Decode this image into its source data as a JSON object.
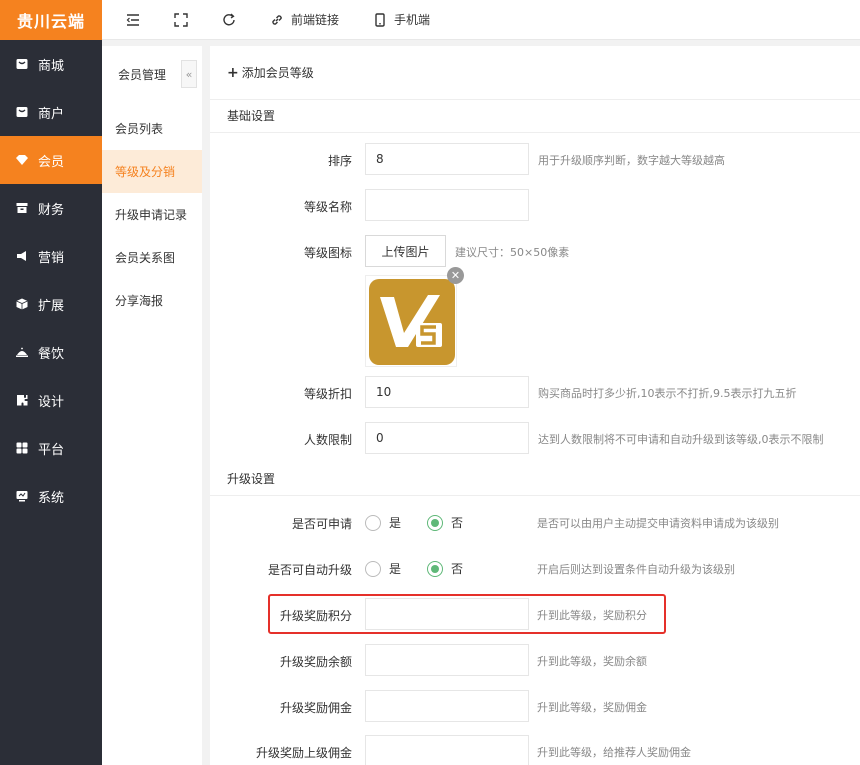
{
  "brand": "贵川云端",
  "nav": [
    {
      "label": "商城",
      "icon": "shop-icon",
      "active": false
    },
    {
      "label": "商户",
      "icon": "merchant-icon",
      "active": false
    },
    {
      "label": "会员",
      "icon": "member-icon",
      "active": true
    },
    {
      "label": "财务",
      "icon": "finance-icon",
      "active": false
    },
    {
      "label": "营销",
      "icon": "marketing-icon",
      "active": false
    },
    {
      "label": "扩展",
      "icon": "extension-icon",
      "active": false
    },
    {
      "label": "餐饮",
      "icon": "dining-icon",
      "active": false
    },
    {
      "label": "设计",
      "icon": "design-icon",
      "active": false
    },
    {
      "label": "平台",
      "icon": "platform-icon",
      "active": false
    },
    {
      "label": "系统",
      "icon": "system-icon",
      "active": false
    }
  ],
  "topbar": {
    "frontend_link": "前端链接",
    "mobile": "手机端"
  },
  "subnav": {
    "title": "会员管理",
    "collapse": "«",
    "items": [
      {
        "label": "会员列表",
        "active": false
      },
      {
        "label": "等级及分销",
        "active": true
      },
      {
        "label": "升级申请记录",
        "active": false
      },
      {
        "label": "会员关系图",
        "active": false
      },
      {
        "label": "分享海报",
        "active": false
      }
    ]
  },
  "main": {
    "add_button": "添加会员等级",
    "basic_section": "基础设置",
    "sort_label": "排序",
    "sort_value": "8",
    "sort_hint": "用于升级顺序判断，数字越大等级越高",
    "name_label": "等级名称",
    "name_value": "",
    "icon_label": "等级图标",
    "upload_button": "上传图片",
    "upload_hint": "建议尺寸：50×50像素",
    "thumb_text": "V5",
    "discount_label": "等级折扣",
    "discount_value": "10",
    "discount_hint": "购买商品时打多少折,10表示不打折,9.5表示打九五折",
    "limit_label": "人数限制",
    "limit_value": "0",
    "limit_hint": "达到人数限制将不可申请和自动升级到该等级,0表示不限制",
    "upgrade_section": "升级设置",
    "apply_label": "是否可申请",
    "apply_yes": "是",
    "apply_no": "否",
    "apply_hint": "是否可以由用户主动提交申请资料申请成为该级别",
    "auto_label": "是否可自动升级",
    "auto_yes": "是",
    "auto_no": "否",
    "auto_hint": "开启后则达到设置条件自动升级为该级别",
    "points_label": "升级奖励积分",
    "points_value": "",
    "points_hint": "升到此等级，奖励积分",
    "balance_label": "升级奖励余额",
    "balance_value": "",
    "balance_hint": "升到此等级，奖励余额",
    "commission_label": "升级奖励佣金",
    "commission_value": "",
    "commission_hint": "升到此等级，奖励佣金",
    "parent_label": "升级奖励上级佣金",
    "parent_value": "",
    "parent_hint": "升到此等级，给推荐人奖励佣金"
  },
  "colors": {
    "accent": "#f5821f",
    "sidebar": "#2b2e37",
    "radio_checked": "#5fb878",
    "highlight": "#e5302a"
  }
}
